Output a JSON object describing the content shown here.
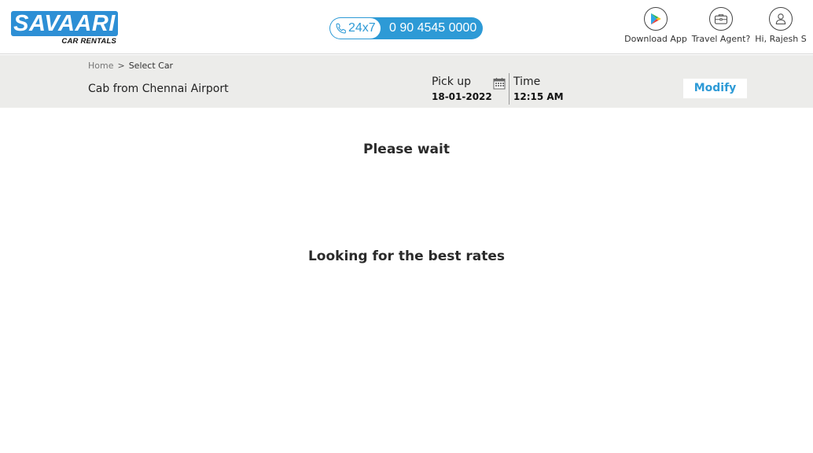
{
  "header": {
    "logo_text": "SAVAARI",
    "logo_subtext": "CAR RENTALS",
    "hotline_tag": "24x7",
    "hotline_number": "0 90 4545 0000",
    "nav": {
      "download_app": "Download App",
      "travel_agent": "Travel Agent?",
      "user_greeting": "Hi, Rajesh S"
    }
  },
  "search_bar": {
    "breadcrumb": {
      "home": "Home",
      "separator": ">",
      "current": "Select Car"
    },
    "route": "Cab from Chennai Airport",
    "pickup_label": "Pick up",
    "pickup_date": "18-01-2022",
    "time_label": "Time",
    "time_value": "12:15 AM",
    "modify_label": "Modify"
  },
  "loading": {
    "primary": "Please wait",
    "secondary": "Looking for the best rates"
  },
  "colors": {
    "brand_blue": "#2d9ad6",
    "logo_blue": "#2d8fd5",
    "subbar_bg": "#ececea"
  },
  "icons": {
    "phone": "phone-icon",
    "download_app": "play-store-icon",
    "travel_agent": "briefcase-icon",
    "user": "user-icon",
    "calendar": "calendar-icon"
  }
}
